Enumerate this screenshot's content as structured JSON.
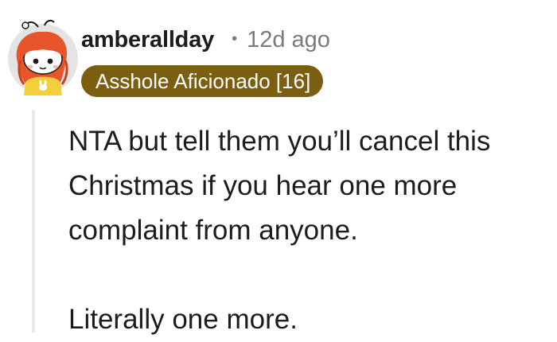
{
  "comment": {
    "username": "amberallday",
    "separator": "•",
    "timestamp": "12d ago",
    "flair": "Asshole Aficionado [16]",
    "avatar_icon": "snoo-avatar-icon",
    "paragraphs": [
      "NTA but tell them you’ll cancel this Christmas if you hear one more complaint from anyone.",
      "Literally one more."
    ]
  },
  "colors": {
    "flair_bg": "#7c5e10",
    "flair_text": "#ffffff",
    "meta_gray": "#787c7e",
    "text": "#1c1c1c",
    "thread_line": "#e9e9e9",
    "avatar_hair": "#e8552a",
    "avatar_shirt": "#f5cf3a"
  }
}
